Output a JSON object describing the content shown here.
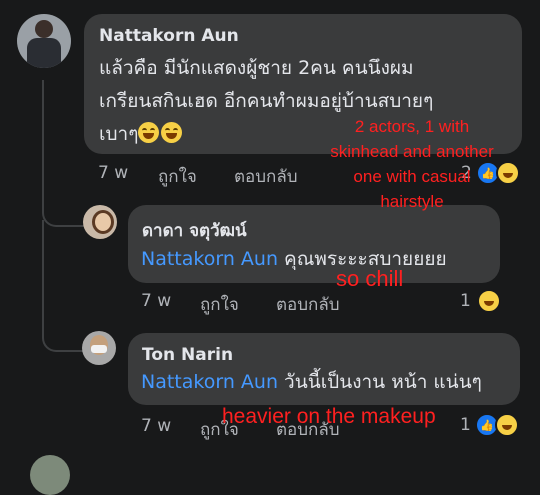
{
  "comments": [
    {
      "author": "Nattakorn Aun",
      "text_lines": [
        "แล้วคือ มีนักแสดงผู้ชาย 2คน คนนึงผม",
        "เกรียนสกินเฮด อีกคนทำผมอยู่บ้านสบายๆ",
        "เบาๆ"
      ],
      "time": "7 w",
      "like_label": "ถูกใจ",
      "reply_label": "ตอบกลับ",
      "reaction_count": "2",
      "reactions": [
        "like-icon",
        "haha-icon"
      ]
    },
    {
      "author": "ดาดา จตุวัฒน์",
      "mention": "Nattakorn Aun",
      "text": "คุณพระะะสบายยยย",
      "time": "7 w",
      "like_label": "ถูกใจ",
      "reply_label": "ตอบกลับ",
      "reaction_count": "1",
      "reactions": [
        "haha-icon"
      ]
    },
    {
      "author": "Ton Narin",
      "mention": "Nattakorn Aun",
      "text": "วันนี้เป็นงาน หน้า แน่นๆ",
      "time": "7 w",
      "like_label": "ถูกใจ",
      "reply_label": "ตอบกลับ",
      "reaction_count": "1",
      "reactions": [
        "like-icon",
        "haha-icon"
      ]
    }
  ],
  "annotations": {
    "first": [
      "2 actors, 1 with",
      "skinhead and another",
      "one with casual",
      "hairstyle"
    ],
    "second": "so chill",
    "third": "heavier on the makeup"
  },
  "colors": {
    "background": "#18191a",
    "bubble": "#3a3b3c",
    "mention": "#4599ff",
    "annotation": "#ff2020",
    "like": "#1877f2"
  }
}
